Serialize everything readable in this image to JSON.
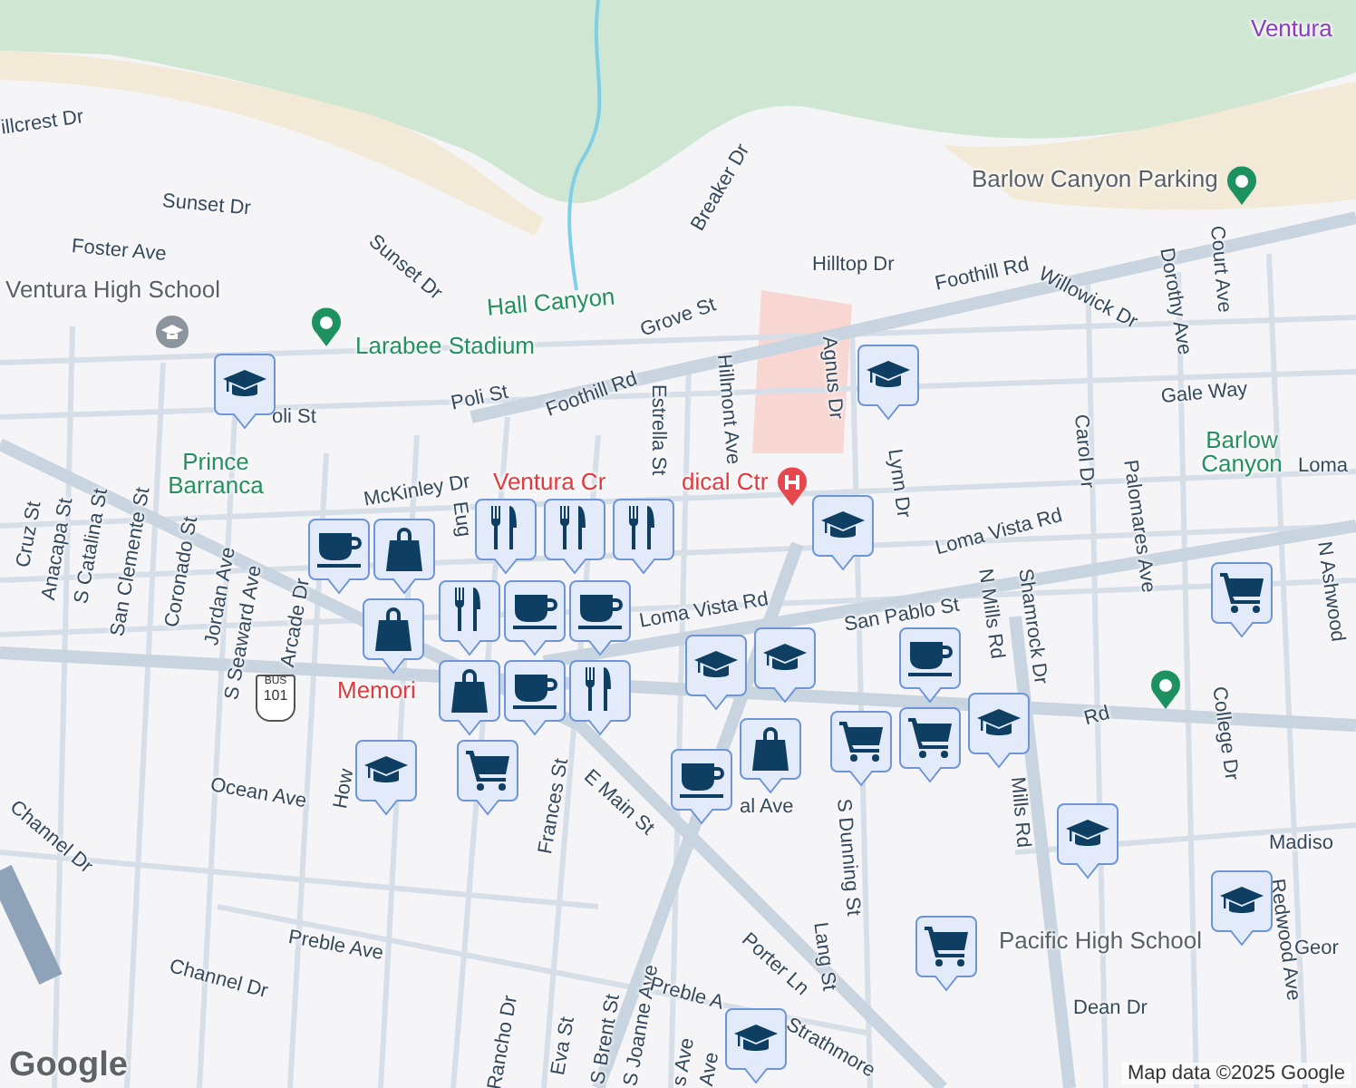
{
  "map": {
    "labels": [
      {
        "text": "illcrest Dr",
        "kind": "street"
      },
      {
        "text": "Sunset Dr",
        "kind": "street"
      },
      {
        "text": "Foster Ave",
        "kind": "street"
      },
      {
        "text": "Sunset Dr",
        "kind": "street"
      },
      {
        "text": "Ventura High School",
        "kind": "landmark"
      },
      {
        "text": "Hall Canyon",
        "kind": "park"
      },
      {
        "text": "Larabee Stadium",
        "kind": "park"
      },
      {
        "text": "Grove St",
        "kind": "street"
      },
      {
        "text": "Breaker Dr",
        "kind": "street"
      },
      {
        "text": "Hilltop Dr",
        "kind": "street"
      },
      {
        "text": "Foothill Rd",
        "kind": "street"
      },
      {
        "text": "Foothill Rd",
        "kind": "street"
      },
      {
        "text": "Willowick Dr",
        "kind": "street"
      },
      {
        "text": "Dorothy Ave",
        "kind": "street"
      },
      {
        "text": "Court Ave",
        "kind": "street"
      },
      {
        "text": "Barlow Canyon Parking",
        "kind": "landmark"
      },
      {
        "text": "Ventura",
        "kind": "district"
      },
      {
        "text": "oli St",
        "kind": "street"
      },
      {
        "text": "Poli St",
        "kind": "street"
      },
      {
        "text": "Estrella St",
        "kind": "street"
      },
      {
        "text": "Hillmont Ave",
        "kind": "street"
      },
      {
        "text": "Agnus Dr",
        "kind": "street"
      },
      {
        "text": "Gale Way",
        "kind": "street"
      },
      {
        "text": "Lynn Dr",
        "kind": "street"
      },
      {
        "text": "Carol Dr",
        "kind": "street"
      },
      {
        "text": "Prince Barranca",
        "kind": "park"
      },
      {
        "text": "Barlow Canyon",
        "kind": "park"
      },
      {
        "text": "Loma",
        "kind": "street"
      },
      {
        "text": "McKinley Dr",
        "kind": "street"
      },
      {
        "text": "Ventura Cr",
        "kind": "medical"
      },
      {
        "text": "dical Ctr",
        "kind": "medical"
      },
      {
        "text": "Loma Vista Rd",
        "kind": "street"
      },
      {
        "text": "Loma Vista Rd",
        "kind": "street"
      },
      {
        "text": "San Pablo St",
        "kind": "street"
      },
      {
        "text": "N Mills Rd",
        "kind": "street"
      },
      {
        "text": "Shamrock Dr",
        "kind": "street"
      },
      {
        "text": "Palomares Ave",
        "kind": "street"
      },
      {
        "text": "N Ashwood",
        "kind": "street"
      },
      {
        "text": "Cruz St",
        "kind": "street"
      },
      {
        "text": "Anacapa St",
        "kind": "street"
      },
      {
        "text": "S Catalina St",
        "kind": "street"
      },
      {
        "text": "San Clemente St",
        "kind": "street"
      },
      {
        "text": "Coronado St",
        "kind": "street"
      },
      {
        "text": "Jordan Ave",
        "kind": "street"
      },
      {
        "text": "S Seaward Ave",
        "kind": "street"
      },
      {
        "text": "Arcade Dr",
        "kind": "street"
      },
      {
        "text": "Eug",
        "kind": "street"
      },
      {
        "text": "Memori",
        "kind": "medical"
      },
      {
        "text": "Rd",
        "kind": "street"
      },
      {
        "text": "College Dr",
        "kind": "street"
      },
      {
        "text": "al Ave",
        "kind": "street"
      },
      {
        "text": "Ocean Ave",
        "kind": "street"
      },
      {
        "text": "How",
        "kind": "street"
      },
      {
        "text": "Frances St",
        "kind": "street"
      },
      {
        "text": "E Main St",
        "kind": "street"
      },
      {
        "text": "S Dunning St",
        "kind": "street"
      },
      {
        "text": "Lang St",
        "kind": "street"
      },
      {
        "text": "Mills Rd",
        "kind": "street"
      },
      {
        "text": "Madiso",
        "kind": "street"
      },
      {
        "text": "Redwood Ave",
        "kind": "street"
      },
      {
        "text": "Geor",
        "kind": "street"
      },
      {
        "text": "Pacific High School",
        "kind": "landmark"
      },
      {
        "text": "Dean Dr",
        "kind": "street"
      },
      {
        "text": "Channel Dr",
        "kind": "street"
      },
      {
        "text": "Channel Dr",
        "kind": "street"
      },
      {
        "text": "Preble Ave",
        "kind": "street"
      },
      {
        "text": "Rancho Dr",
        "kind": "street"
      },
      {
        "text": "Eva St",
        "kind": "street"
      },
      {
        "text": "S Brent St",
        "kind": "street"
      },
      {
        "text": "S Joanne Ave",
        "kind": "street"
      },
      {
        "text": "Preble A",
        "kind": "street"
      },
      {
        "text": "Porter Ln",
        "kind": "street"
      },
      {
        "text": "Strathmore",
        "kind": "street"
      },
      {
        "text": "s Ave",
        "kind": "street"
      },
      {
        "text": "Ave",
        "kind": "street"
      }
    ],
    "markers": [
      {
        "kind": "school"
      },
      {
        "kind": "school"
      },
      {
        "kind": "food"
      },
      {
        "kind": "food"
      },
      {
        "kind": "school"
      },
      {
        "kind": "food"
      },
      {
        "kind": "coffee"
      },
      {
        "kind": "shopping"
      },
      {
        "kind": "food"
      },
      {
        "kind": "grocery"
      },
      {
        "kind": "coffee"
      },
      {
        "kind": "coffee"
      },
      {
        "kind": "shopping"
      },
      {
        "kind": "school"
      },
      {
        "kind": "coffee"
      },
      {
        "kind": "school"
      },
      {
        "kind": "coffee"
      },
      {
        "kind": "food"
      },
      {
        "kind": "shopping"
      },
      {
        "kind": "grocery"
      },
      {
        "kind": "school"
      },
      {
        "kind": "shopping"
      },
      {
        "kind": "grocery"
      },
      {
        "kind": "grocery"
      },
      {
        "kind": "school"
      },
      {
        "kind": "coffee"
      },
      {
        "kind": "school"
      },
      {
        "kind": "school"
      },
      {
        "kind": "grocery"
      },
      {
        "kind": "school"
      }
    ],
    "highway_shield": {
      "top": "BUS",
      "number": "101"
    },
    "logo": "Google",
    "attribution": "Map data ©2025 Google"
  }
}
